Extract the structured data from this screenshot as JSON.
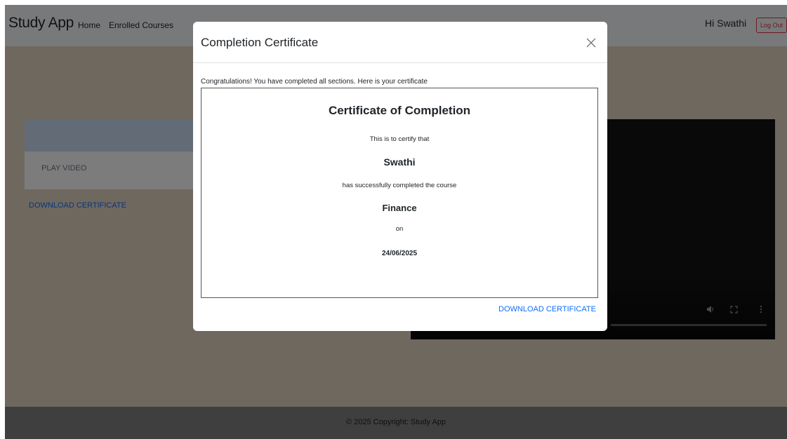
{
  "navbar": {
    "brand": "Study App",
    "links": [
      "Home",
      "Enrolled Courses"
    ],
    "greeting": "Hi Swathi",
    "logout_label": "Log Out"
  },
  "sidebar": {
    "play_video_label": "PLAY VIDEO",
    "download_label": "DOWNLOAD CERTIFICATE"
  },
  "footer": {
    "text": "© 2025 Copyright: Study App"
  },
  "modal": {
    "title": "Completion Certificate",
    "intro": "Congratulations! You have completed all sections. Here is your certificate",
    "certificate": {
      "heading": "Certificate of Completion",
      "certify_line": "This is to certify that",
      "recipient": "Swathi",
      "completed_line": "has successfully completed the course",
      "course": "Finance",
      "on_label": "on",
      "date": "24/06/2025"
    },
    "download_label": "DOWNLOAD CERTIFICATE"
  },
  "colors": {
    "page_bg": "#ded0bf",
    "navbar_bg": "#f1f2f4",
    "accordion_header": "#c7d6ec",
    "link": "#0d6efd",
    "logout": "#dc3545",
    "footer_bg": "#7f7f7f"
  },
  "icons": {
    "close": "close-icon",
    "volume": "volume-icon",
    "fullscreen": "fullscreen-icon",
    "more": "more-options-icon"
  }
}
